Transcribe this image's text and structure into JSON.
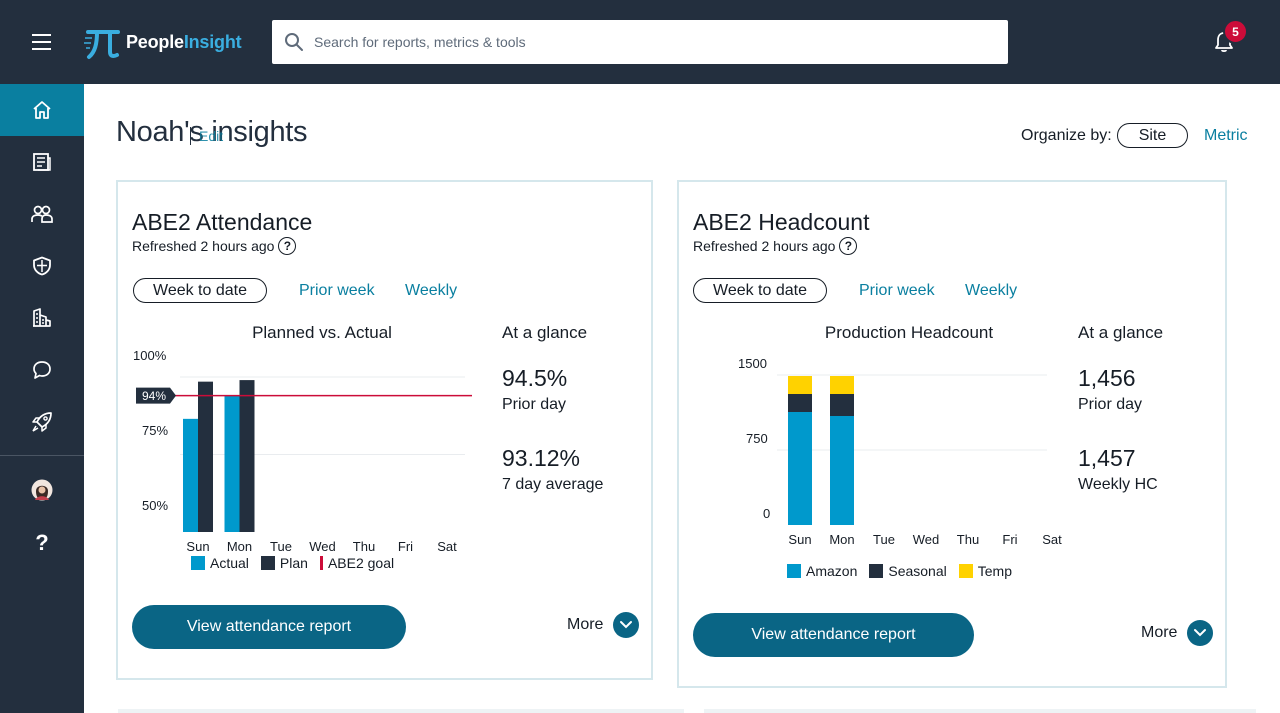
{
  "header": {
    "logo_primary": "People",
    "logo_accent": "Insight",
    "search_placeholder": "Search for reports, metrics & tools",
    "notification_count": "5"
  },
  "sidebar": {
    "items": [
      {
        "icon": "home-icon",
        "active": true
      },
      {
        "icon": "document-icon"
      },
      {
        "icon": "people-icon"
      },
      {
        "icon": "shield-icon"
      },
      {
        "icon": "buildings-icon"
      },
      {
        "icon": "chat-icon"
      },
      {
        "icon": "rocket-icon"
      },
      {
        "icon": "avatar"
      },
      {
        "icon": "help-icon",
        "label": "?"
      }
    ]
  },
  "page": {
    "title": "Noah's insights",
    "edit_label": "Edit",
    "organize_label": "Organize by:",
    "organize_options": [
      "Site",
      "Metric"
    ]
  },
  "cards": [
    {
      "title": "ABE2 Attendance",
      "refreshed": "Refreshed 2 hours ago",
      "tabs": [
        "Week to date",
        "Prior week",
        "Weekly"
      ],
      "chart_title": "Planned vs. Actual",
      "glance_title": "At a glance",
      "glance": [
        {
          "value": "94.5%",
          "label": "Prior day"
        },
        {
          "value": "93.12%",
          "label": "7 day average"
        }
      ],
      "button_label": "View attendance report",
      "more_label": "More"
    },
    {
      "title": "ABE2 Headcount",
      "refreshed": "Refreshed 2 hours ago",
      "tabs": [
        "Week to date",
        "Prior week",
        "Weekly"
      ],
      "chart_title": "Production Headcount",
      "glance_title": "At a glance",
      "glance": [
        {
          "value": "1,456",
          "label": "Prior day"
        },
        {
          "value": "1,457",
          "label": "Weekly HC"
        }
      ],
      "button_label": "View attendance report",
      "more_label": "More"
    }
  ],
  "colors": {
    "topbar": "#232f3e",
    "accent": "#0a7fa0",
    "button": "#0a6585",
    "actual": "#0099cc",
    "plan": "#232f3e",
    "goal": "#cc0c39",
    "temp": "#ffd200",
    "badge": "#cc0c39"
  },
  "chart_data": [
    {
      "type": "bar",
      "title": "Planned vs. Actual",
      "categories": [
        "Sun",
        "Mon",
        "Tue",
        "Wed",
        "Thu",
        "Fri",
        "Sat"
      ],
      "series": [
        {
          "name": "Actual",
          "values": [
            86.5,
            94,
            null,
            null,
            null,
            null,
            null
          ]
        },
        {
          "name": "Plan",
          "values": [
            98.5,
            99,
            null,
            null,
            null,
            null,
            null
          ]
        }
      ],
      "goal": {
        "name": "ABE2 goal",
        "value": 94,
        "label": "94%"
      },
      "ylim": [
        50,
        100
      ],
      "yticks": [
        "100%",
        "75%",
        "50%"
      ],
      "legend": [
        "Actual",
        "Plan",
        "ABE2 goal"
      ]
    },
    {
      "type": "bar",
      "stacked": true,
      "title": "Production Headcount",
      "categories": [
        "Sun",
        "Mon",
        "Tue",
        "Wed",
        "Thu",
        "Fri",
        "Sat"
      ],
      "series": [
        {
          "name": "Amazon",
          "values": [
            1130,
            1090,
            null,
            null,
            null,
            null,
            null
          ]
        },
        {
          "name": "Seasonal",
          "values": [
            180,
            220,
            null,
            null,
            null,
            null,
            null
          ]
        },
        {
          "name": "Temp",
          "values": [
            180,
            180,
            null,
            null,
            null,
            null,
            null
          ]
        }
      ],
      "ylim": [
        0,
        1500
      ],
      "yticks": [
        "1500",
        "750",
        "0"
      ],
      "legend": [
        "Amazon",
        "Seasonal",
        "Temp"
      ]
    }
  ]
}
